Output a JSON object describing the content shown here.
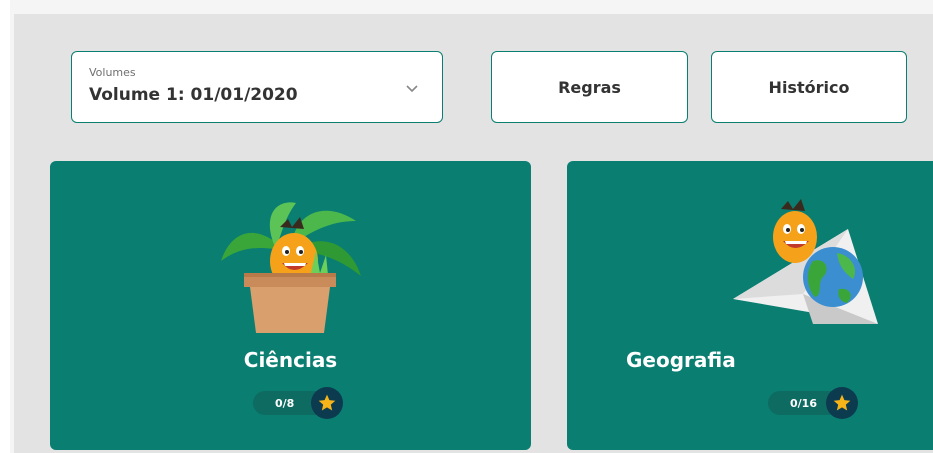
{
  "volume_select": {
    "caption": "Volumes",
    "value": "Volume 1: 01/01/2020"
  },
  "buttons": {
    "rules": "Regras",
    "history": "Histórico"
  },
  "subjects": [
    {
      "name": "Ciências",
      "progress": "0/8"
    },
    {
      "name": "Geografia",
      "progress": "0/16"
    }
  ],
  "colors": {
    "accent": "#0a7e71",
    "star": "#f6b419",
    "star_bg": "#0c3b50"
  }
}
